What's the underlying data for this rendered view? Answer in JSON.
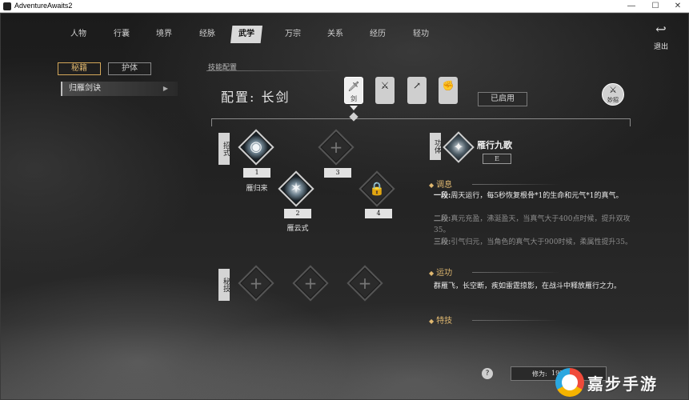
{
  "window": {
    "title": "AdventureAwaits2",
    "min": "—",
    "max": "☐",
    "close": "✕"
  },
  "nav": {
    "items": [
      "人物",
      "行囊",
      "境界",
      "经脉",
      "武学",
      "万宗",
      "关系",
      "经历",
      "轻功"
    ],
    "active_index": 4,
    "exit_label": "退出",
    "exit_icon": "↩"
  },
  "left_panel": {
    "tabs": [
      "秘籍",
      "护体"
    ],
    "active_tab": 0,
    "skill_item": "归雁剑诀",
    "skill_item_arrow": "▶"
  },
  "config": {
    "section_label": "技能配置",
    "title": "配置: 长剑",
    "weapon_slots": [
      {
        "icon": "sword-icon",
        "glyph": "🗡",
        "label": "剑",
        "active": true
      },
      {
        "icon": "blade-icon",
        "glyph": "⚔",
        "label": "",
        "active": false
      },
      {
        "icon": "spear-icon",
        "glyph": "↗",
        "label": "",
        "active": false
      },
      {
        "icon": "fist-icon",
        "glyph": "✊",
        "label": "",
        "active": false
      }
    ],
    "enabled_label": "已启用",
    "tips_label": "妙招",
    "tips_icon": "⚔"
  },
  "moves": {
    "label": "招式",
    "nodes": [
      {
        "slot": "1",
        "name": "雁归来",
        "state": "filled",
        "glyph": "◉"
      },
      {
        "slot": "2",
        "name": "雁云式",
        "state": "filled",
        "glyph": "✶"
      },
      {
        "slot": "3",
        "name": "",
        "state": "empty",
        "glyph": "+"
      },
      {
        "slot": "4",
        "name": "",
        "state": "locked",
        "glyph": "🔒"
      }
    ]
  },
  "secret_moves": {
    "label": "秘技",
    "nodes": [
      {
        "state": "empty",
        "glyph": "+"
      },
      {
        "state": "empty",
        "glyph": "+"
      },
      {
        "state": "empty",
        "glyph": "+"
      }
    ]
  },
  "detail": {
    "side_label": "功体",
    "title": "雁行九歌",
    "grade": "E",
    "icon_glyph": "✦",
    "sections": {
      "tune": {
        "heading": "调息",
        "stages": [
          {
            "stage": "一段:",
            "text": "周天运行，每5秒恢复根骨*1的生命和元气*1的真气。",
            "active": true
          },
          {
            "stage": "二段:",
            "text": "真元充盈，沸涎盈天，当真气大于400点时候，提升双攻35。",
            "active": false
          },
          {
            "stage": "三段:",
            "text": "引气归元，当角色的真气大于900时候，柔属性提升35。",
            "active": false
          }
        ]
      },
      "motion": {
        "heading": "运功",
        "text": "群雁飞，长空断，疾如雷霆掠影，在战斗中释放雁行之力。"
      },
      "special": {
        "heading": "特技"
      },
      "bullet": "◆"
    }
  },
  "bottom": {
    "help_icon": "?",
    "cultivation_label": "修为:",
    "cultivation_value": "19?4"
  },
  "watermark": {
    "text": "嘉步手游"
  }
}
